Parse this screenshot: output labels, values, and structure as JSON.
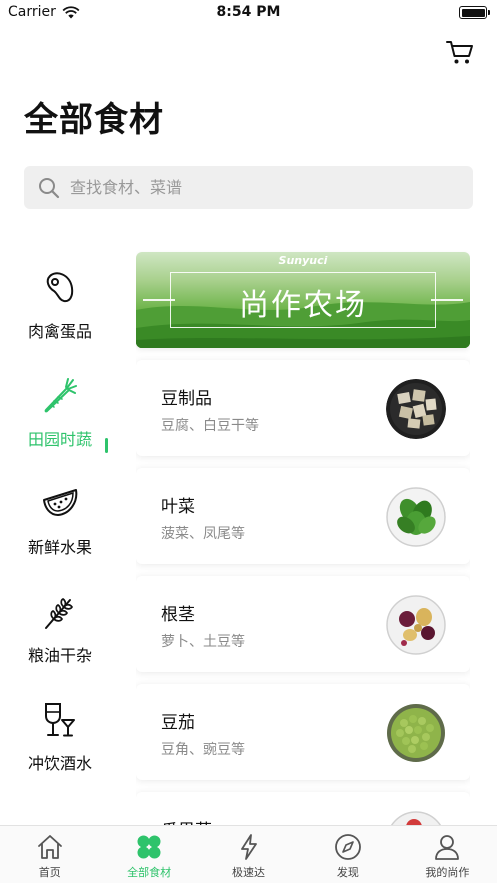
{
  "status_bar": {
    "carrier": "Carrier",
    "time": "8:54 PM"
  },
  "header": {
    "title": "全部食材",
    "cart_icon": "cart-icon"
  },
  "search": {
    "placeholder": "查找食材、菜谱",
    "value": ""
  },
  "colors": {
    "accent": "#2ec36b",
    "text": "#111111",
    "subtext": "#8a8a8a",
    "search_bg": "#efefef"
  },
  "sidebar": {
    "items": [
      {
        "label": "肉禽蛋品",
        "icon": "meat-icon",
        "active": false
      },
      {
        "label": "田园时蔬",
        "icon": "carrot-icon",
        "active": true
      },
      {
        "label": "新鲜水果",
        "icon": "watermelon-icon",
        "active": false
      },
      {
        "label": "粮油干杂",
        "icon": "wheat-icon",
        "active": false
      },
      {
        "label": "冲饮酒水",
        "icon": "drinks-icon",
        "active": false
      },
      {
        "label": "",
        "icon": "more-icon",
        "active": false
      }
    ]
  },
  "banner": {
    "brand": "Sunyuci",
    "text": "尚作农场"
  },
  "cards": [
    {
      "title": "豆制品",
      "subtitle": "豆腐、白豆干等",
      "image": "tofu-thumb"
    },
    {
      "title": "叶菜",
      "subtitle": "菠菜、凤尾等",
      "image": "leafy-greens-thumb"
    },
    {
      "title": "根茎",
      "subtitle": "萝卜、土豆等",
      "image": "root-vegetables-thumb"
    },
    {
      "title": "豆茄",
      "subtitle": "豆角、豌豆等",
      "image": "peas-thumb"
    },
    {
      "title": "瓜果菜",
      "subtitle": "",
      "image": "melon-thumb"
    }
  ],
  "tab_bar": {
    "items": [
      {
        "label": "首页",
        "icon": "home-icon",
        "active": false
      },
      {
        "label": "全部食材",
        "icon": "clover-icon",
        "active": true
      },
      {
        "label": "极速达",
        "icon": "lightning-icon",
        "active": false
      },
      {
        "label": "发现",
        "icon": "compass-icon",
        "active": false
      },
      {
        "label": "我的尚作",
        "icon": "person-icon",
        "active": false
      }
    ]
  }
}
